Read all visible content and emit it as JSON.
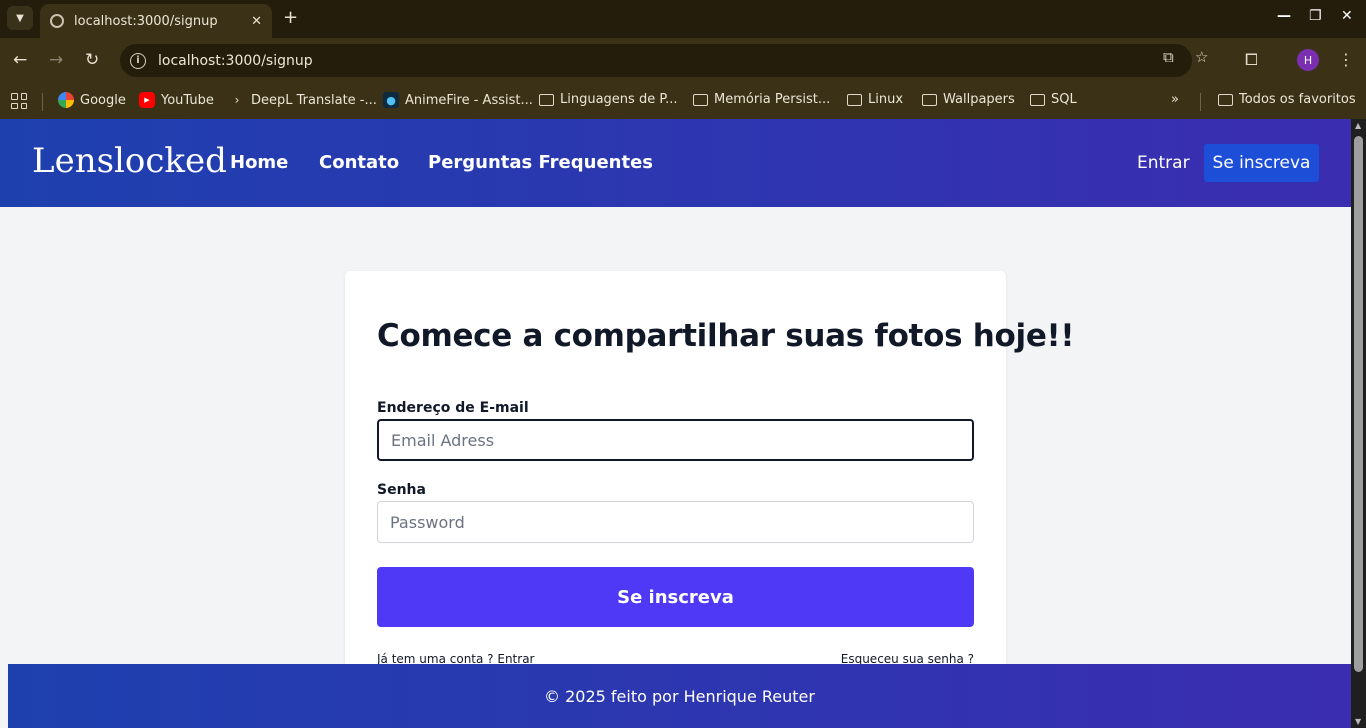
{
  "browser": {
    "tab_title": "localhost:3000/signup",
    "url": "localhost:3000/signup",
    "profile_initial": "H",
    "bookmarks": [
      {
        "label": "Google",
        "icon": "google-icon"
      },
      {
        "label": "YouTube",
        "icon": "youtube-icon"
      },
      {
        "label": "DeepL Translate -...",
        "icon": "deepl-icon"
      },
      {
        "label": "AnimeFire - Assist...",
        "icon": "animefire-icon"
      },
      {
        "label": "Linguagens de P...",
        "icon": "folder-icon"
      },
      {
        "label": "Memória Persist...",
        "icon": "folder-icon"
      },
      {
        "label": "Linux",
        "icon": "folder-icon"
      },
      {
        "label": "Wallpapers",
        "icon": "folder-icon"
      },
      {
        "label": "SQL",
        "icon": "folder-icon"
      }
    ],
    "all_bookmarks_label": "Todos os favoritos"
  },
  "header": {
    "logo": "Lenslocked",
    "nav": [
      "Home",
      "Contato",
      "Perguntas Frequentes"
    ],
    "login": "Entrar",
    "signup": "Se inscreva"
  },
  "form": {
    "title": "Comece a compartilhar suas fotos hoje!!",
    "email_label": "Endereço de E-mail",
    "email_placeholder": "Email Adress",
    "password_label": "Senha",
    "password_placeholder": "Password",
    "submit": "Se inscreva",
    "have_account": "Já tem uma conta ? Entrar",
    "forgot": "Esqueceu sua senha ?"
  },
  "footer": {
    "text": "© 2025 feito por Henrique Reuter"
  },
  "colors": {
    "header_gradient_start": "#1e40af",
    "header_gradient_end": "#3b2db0",
    "signup_button": "#1d4ed8",
    "submit_button": "#4f39f6",
    "page_background": "#f3f4f6"
  }
}
